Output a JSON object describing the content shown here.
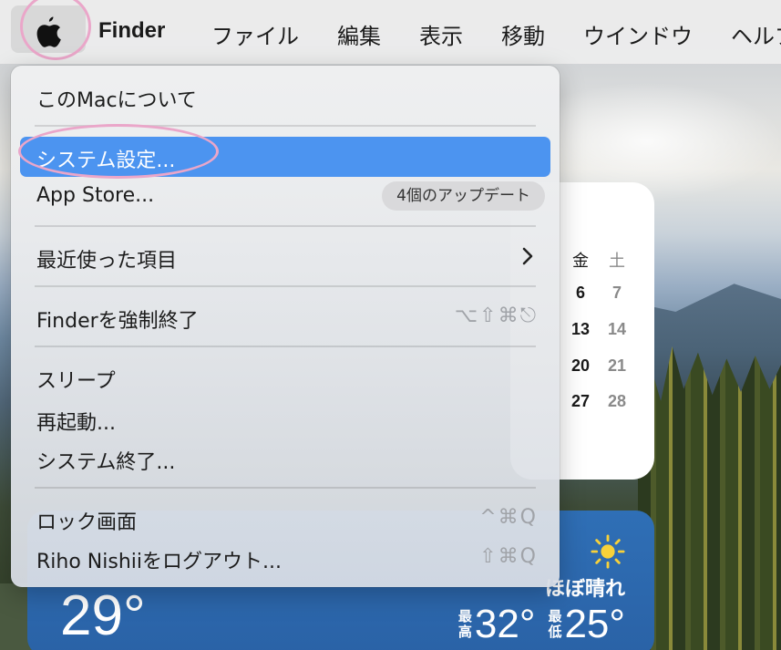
{
  "menubar": {
    "apple_icon": "apple-logo-icon",
    "app_name": "Finder",
    "menus": [
      "ファイル",
      "編集",
      "表示",
      "移動",
      "ウインドウ",
      "ヘルプ"
    ]
  },
  "apple_menu": {
    "about": "このMacについて",
    "system_settings": "システム設定...",
    "app_store": "App Store...",
    "app_store_badge": "4個のアップデート",
    "recent_items": "最近使った項目",
    "force_quit": "Finderを強制終了",
    "force_quit_shortcut": "⌥⇧⌘⎋",
    "sleep": "スリープ",
    "restart": "再起動...",
    "shutdown": "システム終了...",
    "lock_screen": "ロック画面",
    "lock_screen_shortcut": "^⌘Q",
    "logout": "Riho Nishiiをログアウト...",
    "logout_shortcut": "⇧⌘Q",
    "selected_color": "#4c94f0"
  },
  "calendar": {
    "headers": [
      "金",
      "土"
    ],
    "rows": [
      [
        "6",
        "7"
      ],
      [
        "13",
        "14"
      ],
      [
        "20",
        "21"
      ],
      [
        "27",
        "28"
      ]
    ]
  },
  "weather": {
    "temperature": "29°",
    "condition": "ほぼ晴れ",
    "high_label": "最高",
    "high": "32°",
    "low_label": "最低",
    "low": "25°",
    "icon": "sun-icon"
  }
}
